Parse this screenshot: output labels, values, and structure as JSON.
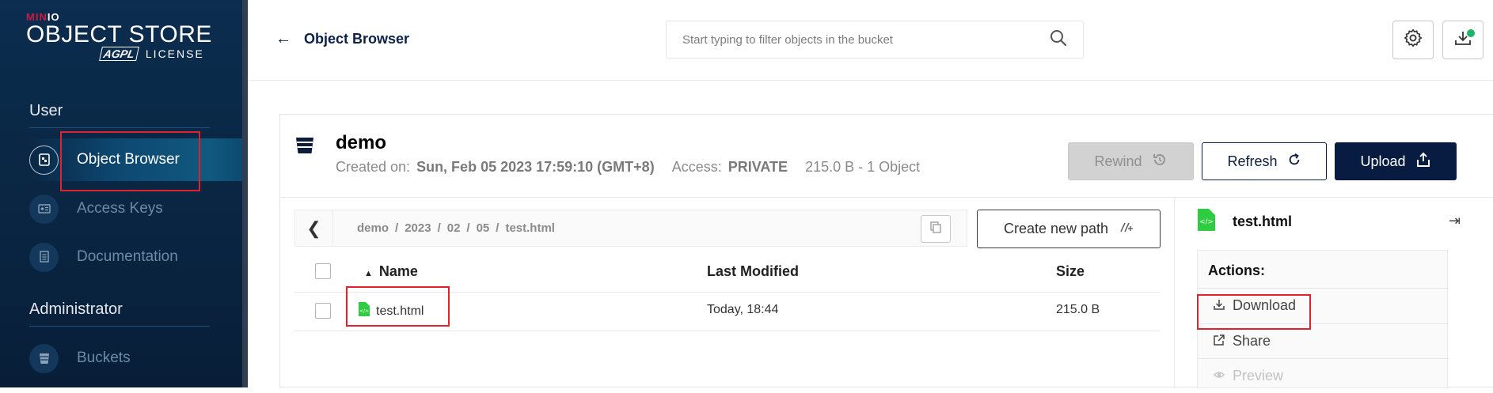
{
  "brand": {
    "minio": "MIN",
    "minio_io": "IO",
    "product": "OBJECT STORE",
    "agpl": "AGPL",
    "license": "LICENSE"
  },
  "sidebar": {
    "user_title": "User",
    "admin_title": "Administrator",
    "items": [
      {
        "label": "Object Browser",
        "icon": "object-browser-icon",
        "active": true
      },
      {
        "label": "Access Keys",
        "icon": "access-keys-icon",
        "active": false
      },
      {
        "label": "Documentation",
        "icon": "documentation-icon",
        "active": false
      },
      {
        "label": "Buckets",
        "icon": "buckets-icon",
        "active": false
      }
    ]
  },
  "header": {
    "back_label": "Object Browser",
    "search_placeholder": "Start typing to filter objects in the bucket"
  },
  "bucket": {
    "name": "demo",
    "created_label": "Created on:",
    "created_value": "Sun, Feb 05 2023 17:59:10 (GMT+8)",
    "access_label": "Access:",
    "access_value": "PRIVATE",
    "summary": "215.0 B - 1 Object"
  },
  "buttons": {
    "rewind": "Rewind",
    "refresh": "Refresh",
    "upload": "Upload",
    "new_path": "Create new path"
  },
  "breadcrumb": [
    "demo",
    "/",
    "2023",
    "/",
    "02",
    "/",
    "05",
    "/",
    "test.html"
  ],
  "table": {
    "columns": [
      "Name",
      "Last Modified",
      "Size"
    ],
    "rows": [
      {
        "name": "test.html",
        "modified": "Today, 18:44",
        "size": "215.0 B"
      }
    ]
  },
  "details": {
    "file_name": "test.html",
    "actions_title": "Actions:",
    "actions": [
      "Download",
      "Share",
      "Preview"
    ]
  },
  "colors": {
    "accent": "#081c42",
    "highlight": "#e0222f",
    "file_icon": "#2ecc40",
    "notify": "#1ab56a"
  }
}
